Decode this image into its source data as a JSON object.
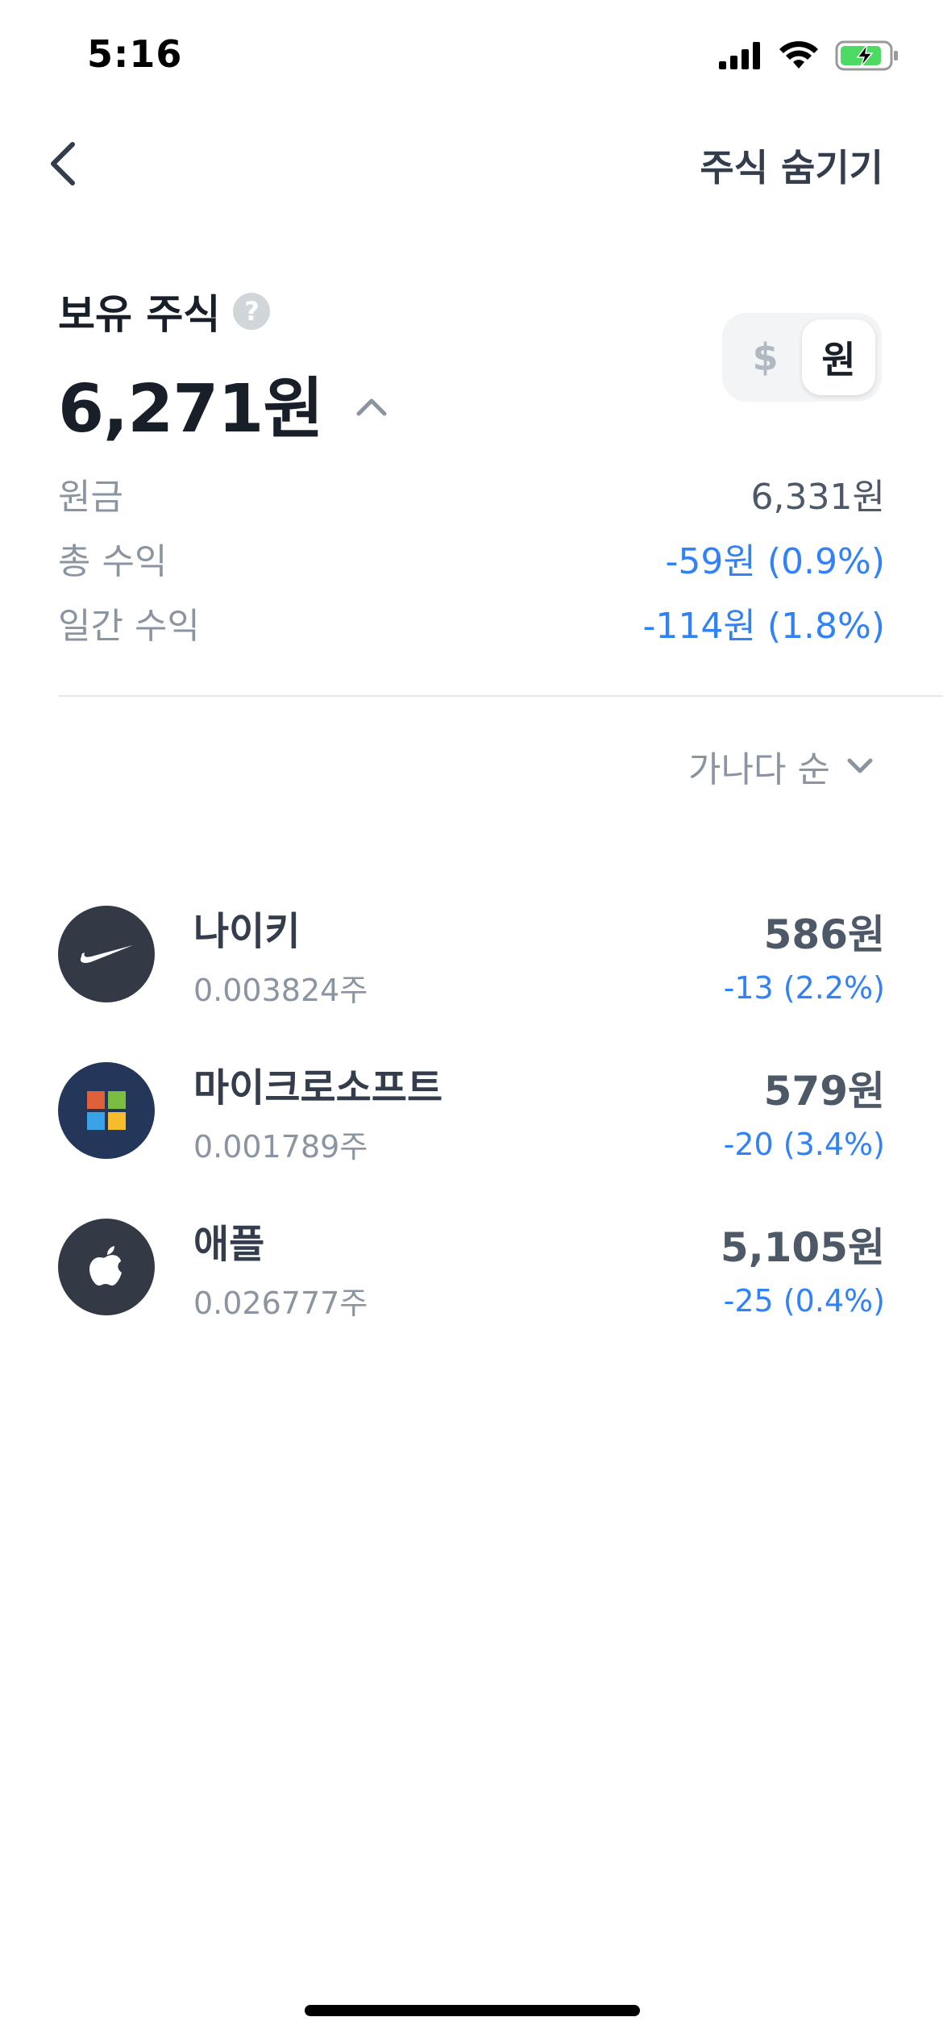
{
  "status_bar": {
    "time": "5:16"
  },
  "header": {
    "hide_label": "주식 숨기기"
  },
  "summary": {
    "title": "보유 주식",
    "help_glyph": "?",
    "total": "6,271원",
    "currency_toggle": {
      "usd": "$",
      "krw": "원",
      "selected": "원"
    },
    "rows": [
      {
        "label": "원금",
        "value": "6,331원"
      },
      {
        "label": "총 수익",
        "value": "-59원 (0.9%)"
      },
      {
        "label": "일간 수익",
        "value": "-114원 (1.8%)"
      }
    ]
  },
  "sort": {
    "label": "가나다 순"
  },
  "stocks": [
    {
      "name": "나이키",
      "shares": "0.003824주",
      "price": "586원",
      "change": "-13 (2.2%)",
      "icon": "nike-logo-icon"
    },
    {
      "name": "마이크로소프트",
      "shares": "0.001789주",
      "price": "579원",
      "change": "-20 (3.4%)",
      "icon": "microsoft-logo-icon"
    },
    {
      "name": "애플",
      "shares": "0.026777주",
      "price": "5,105원",
      "change": "-25 (0.4%)",
      "icon": "apple-logo-icon"
    }
  ],
  "colors": {
    "primary_text": "#191f28",
    "secondary_text": "#8b95a1",
    "loss_blue": "#3182f6",
    "divider": "#e5e8eb"
  }
}
